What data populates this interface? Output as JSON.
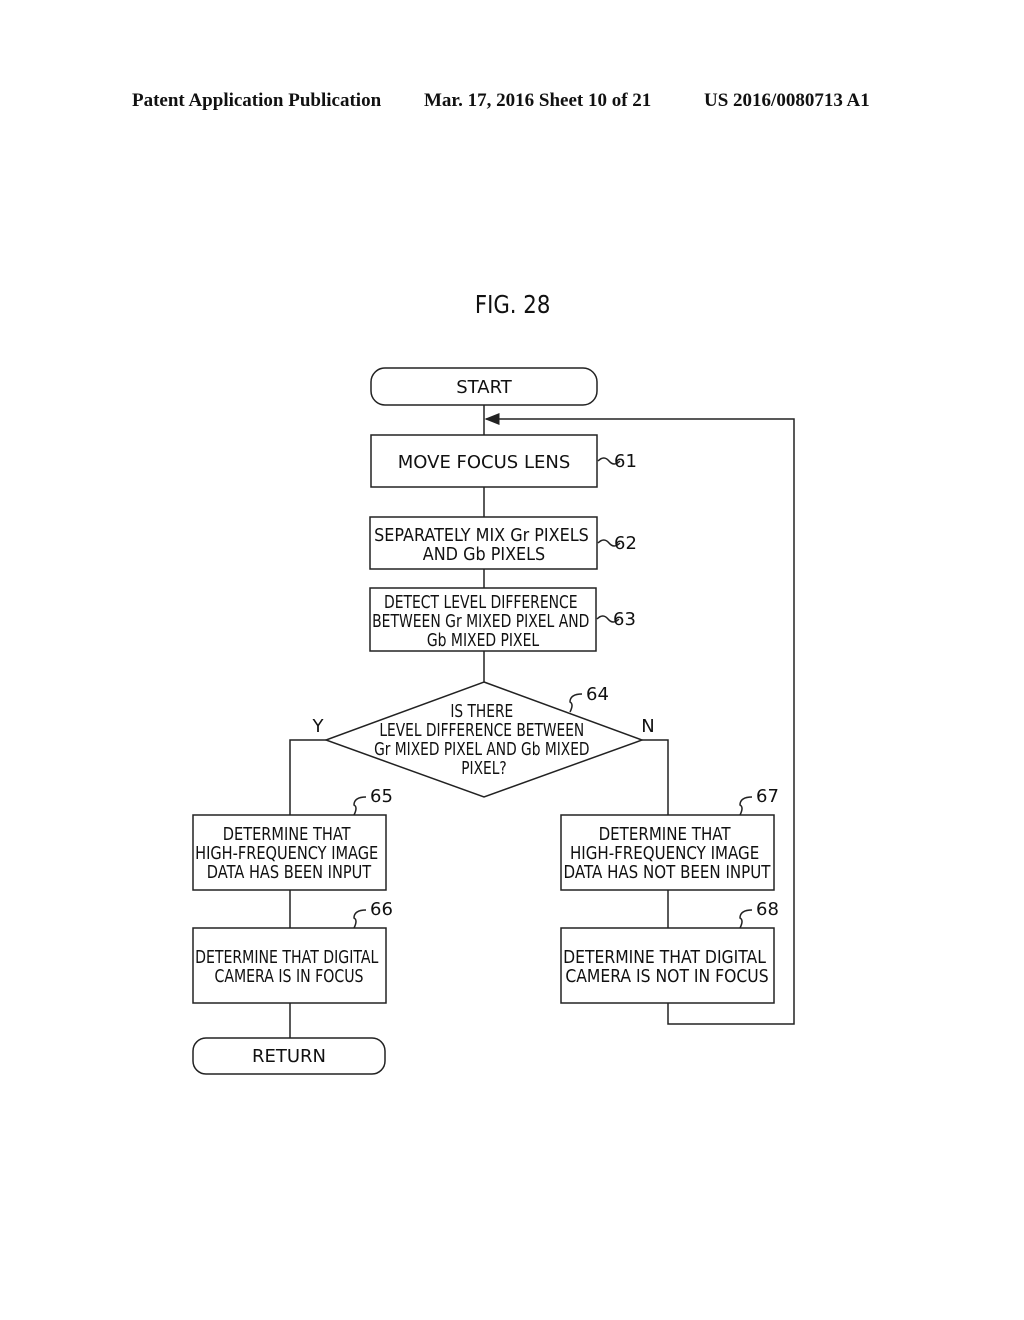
{
  "header": {
    "left": "Patent Application Publication",
    "middle": "Mar. 17, 2016  Sheet 10 of 21",
    "right": "US 2016/0080713 A1"
  },
  "figure": {
    "title": "FIG. 28",
    "nodes": {
      "start": {
        "lines": [
          "START"
        ]
      },
      "s61": {
        "ref": "61",
        "lines": [
          "MOVE FOCUS LENS"
        ]
      },
      "s62": {
        "ref": "62",
        "lines": [
          "SEPARATELY MIX Gr PIXELS",
          "AND Gb PIXELS"
        ]
      },
      "s63": {
        "ref": "63",
        "lines": [
          "DETECT LEVEL DIFFERENCE",
          "BETWEEN Gr MIXED PIXEL AND",
          "Gb MIXED PIXEL"
        ]
      },
      "s64": {
        "ref": "64",
        "lines": [
          "IS THERE",
          "LEVEL DIFFERENCE BETWEEN",
          "Gr MIXED PIXEL AND Gb MIXED",
          "PIXEL?"
        ],
        "yes_label": "Y",
        "no_label": "N"
      },
      "s65": {
        "ref": "65",
        "lines": [
          "DETERMINE THAT",
          "HIGH-FREQUENCY IMAGE",
          "DATA HAS BEEN INPUT"
        ]
      },
      "s66": {
        "ref": "66",
        "lines": [
          "DETERMINE THAT DIGITAL",
          "CAMERA IS IN FOCUS"
        ]
      },
      "s67": {
        "ref": "67",
        "lines": [
          "DETERMINE THAT",
          "HIGH-FREQUENCY IMAGE",
          "DATA HAS NOT BEEN INPUT"
        ]
      },
      "s68": {
        "ref": "68",
        "lines": [
          "DETERMINE THAT DIGITAL",
          "CAMERA IS NOT IN FOCUS"
        ]
      },
      "return": {
        "lines": [
          "RETURN"
        ]
      }
    }
  }
}
